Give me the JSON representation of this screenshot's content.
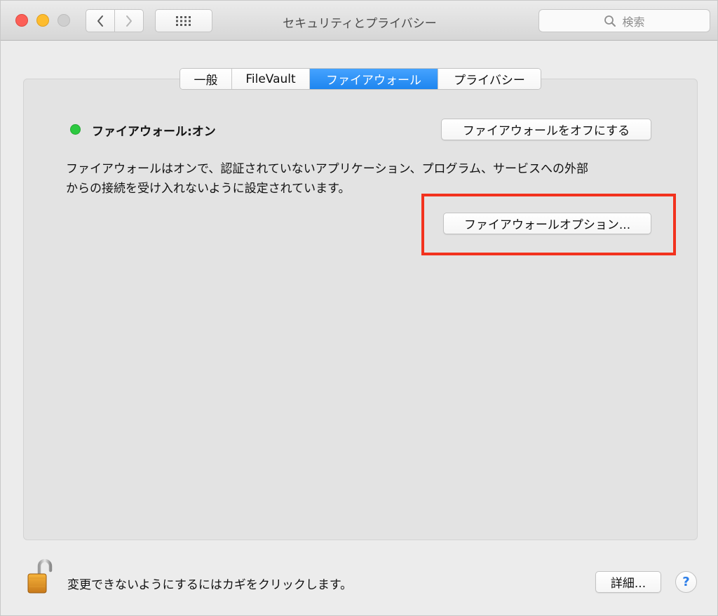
{
  "window": {
    "title": "セキュリティとプライバシー"
  },
  "toolbar": {
    "search_placeholder": "検索"
  },
  "tabs": [
    {
      "label": "一般",
      "active": false
    },
    {
      "label": "FileVault",
      "active": false
    },
    {
      "label": "ファイアウォール",
      "active": true
    },
    {
      "label": "プライバシー",
      "active": false
    }
  ],
  "firewall": {
    "status_label": "ファイアウォール:オン",
    "status_color": "#2cc940",
    "turn_off_button": "ファイアウォールをオフにする",
    "description_line1": "ファイアウォールはオンで、認証されていないアプリケーション、プログラム、サービスへの外部",
    "description_line2": "からの接続を受け入れないように設定されています。",
    "options_button": "ファイアウォールオプション..."
  },
  "footer": {
    "lock_text": "変更できないようにするにはカギをクリックします。",
    "detail_button": "詳細...",
    "help_label": "?"
  },
  "colors": {
    "accent": "#1e86ef",
    "highlight": "#f2321e"
  },
  "icons": [
    "close-icon",
    "minimize-icon",
    "zoom-icon",
    "chevron-left-icon",
    "chevron-right-icon",
    "grid-icon",
    "search-icon",
    "lock-open-icon",
    "help-icon"
  ]
}
